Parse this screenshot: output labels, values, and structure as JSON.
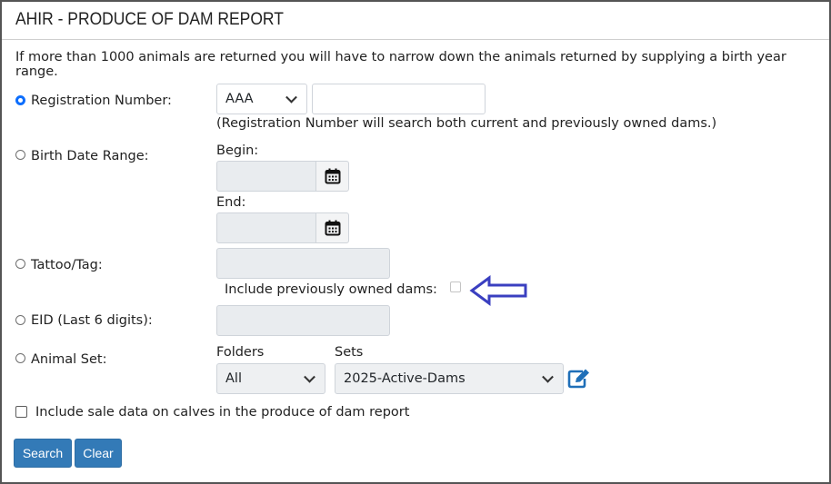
{
  "page": {
    "title": "AHIR - PRODUCE OF DAM REPORT",
    "info": "If more than 1000 animals are returned you will have to narrow down the animals returned by supplying a birth year range."
  },
  "registration": {
    "label": "Registration Number:",
    "checked": true,
    "prefix_selected": "AAA",
    "number_value": "",
    "note": "(Registration Number will search both current and previously owned dams.)"
  },
  "birth_date": {
    "label": "Birth Date Range:",
    "begin_label": "Begin:",
    "end_label": "End:",
    "begin_value": "",
    "end_value": ""
  },
  "tattoo": {
    "label": "Tattoo/Tag:",
    "value": "",
    "include_prev_label": "Include previously owned dams:"
  },
  "eid": {
    "label": "EID (Last 6 digits):",
    "value": ""
  },
  "animal_set": {
    "label": "Animal Set:",
    "folders_label": "Folders",
    "sets_label": "Sets",
    "folder_selected": "All",
    "set_selected": "2025-Active-Dams"
  },
  "sale_data": {
    "label": "Include sale data on calves in the produce of dam report"
  },
  "buttons": {
    "search": "Search",
    "clear": "Clear"
  },
  "colors": {
    "accent": "#337ab7",
    "radio_checked": "#0d6efd",
    "arrow": "#3a3fc0"
  },
  "icons": {
    "calendar": "calendar-icon",
    "edit": "edit-icon",
    "arrow": "arrow-left-icon"
  }
}
